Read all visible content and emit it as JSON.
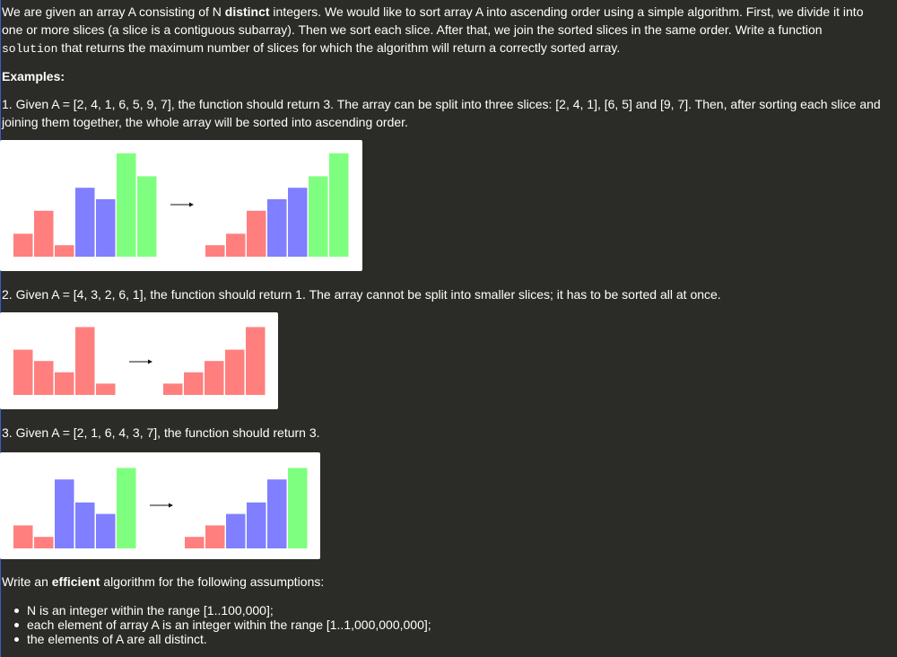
{
  "intro": {
    "line1_pre": "We are given an array A consisting of N ",
    "line1_bold": "distinct",
    "line1_post": " integers. We would like to sort array A into ascending order using a simple algorithm. First, we divide it into",
    "line2": "one or more slices (a slice is a contiguous subarray). Then we sort each slice. After that, we join the sorted slices in the same order. Write a function",
    "line3_code": "solution",
    "line3_post": " that returns the maximum number of slices for which the algorithm will return a correctly sorted array."
  },
  "examples_heading": "Examples:",
  "examples": [
    {
      "line1": "1. Given A = [2, 4, 1, 6, 5, 9, 7], the function should return 3. The array can be split into three slices: [2, 4, 1], [6, 5] and [9, 7]. Then, after sorting each slice and",
      "line2": "joining them together, the whole array will be sorted into ascending order.",
      "values": [
        2,
        4,
        1,
        6,
        5,
        9,
        7
      ],
      "slices": [
        0,
        0,
        0,
        1,
        1,
        2,
        2
      ]
    },
    {
      "line1": "2. Given A = [4, 3, 2, 6, 1], the function should return 1. The array cannot be split into smaller slices; it has to be sorted all at once.",
      "values": [
        4,
        3,
        2,
        6,
        1
      ],
      "slices": [
        0,
        0,
        0,
        0,
        0
      ]
    },
    {
      "line1": "3. Given A = [2, 1, 6, 4, 3, 7], the function should return 3.",
      "values": [
        2,
        1,
        6,
        4,
        3,
        7
      ],
      "slices": [
        0,
        0,
        1,
        1,
        1,
        2
      ]
    }
  ],
  "slice_colors": [
    "#ff7f7f",
    "#7f7fff",
    "#7fff7f"
  ],
  "efficient": {
    "pre": "Write an ",
    "bold": "efficient",
    "post": " algorithm for the following assumptions:"
  },
  "assumptions": [
    "N is an integer within the range [1..100,000];",
    "each element of array A is an integer within the range [1..1,000,000,000];",
    "the elements of A are all distinct."
  ]
}
